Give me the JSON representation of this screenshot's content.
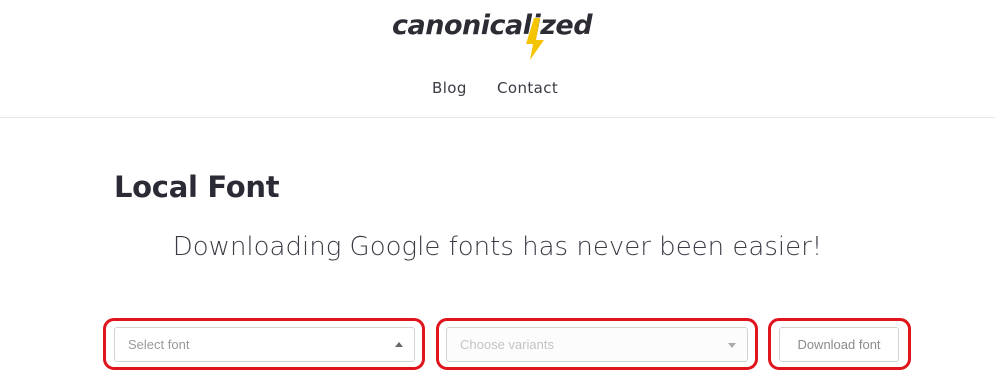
{
  "header": {
    "logo_text": "canonicalized",
    "nav": [
      {
        "label": "Blog"
      },
      {
        "label": "Contact"
      }
    ]
  },
  "main": {
    "title": "Local Font",
    "subtitle": "Downloading Google fonts has never been easier!",
    "font_select": {
      "placeholder": "Select font",
      "icon": "caret-up-icon"
    },
    "variants_select": {
      "placeholder": "Choose variants",
      "icon": "caret-down-icon"
    },
    "download_button": {
      "label": "Download font"
    }
  },
  "colors": {
    "highlight": "#e0141c",
    "logo_accent": "#f5c400",
    "text_dark": "#2b2b35"
  }
}
